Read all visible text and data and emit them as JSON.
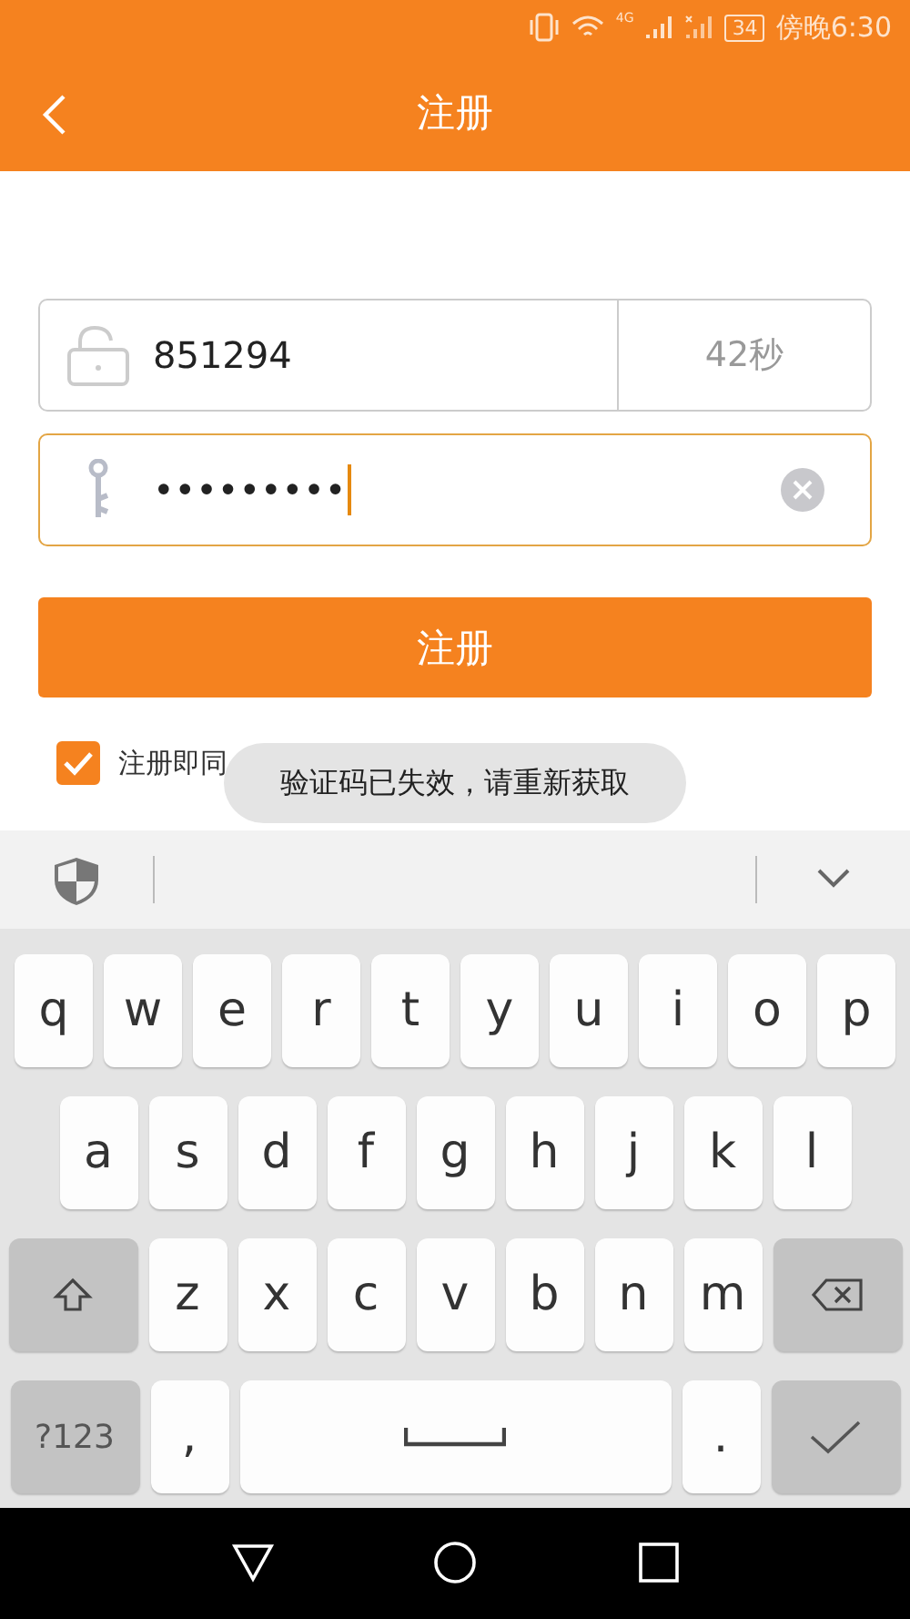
{
  "status_bar": {
    "network": "4G",
    "battery": "34",
    "time": "傍晚6:30"
  },
  "header": {
    "title": "注册"
  },
  "code_field": {
    "value": "851294",
    "countdown": "42秒"
  },
  "password_field": {
    "value": "•••••••••",
    "focused": true
  },
  "submit_button": {
    "label": "注册"
  },
  "agreement": {
    "checked": true,
    "text": "注册即同"
  },
  "toast": {
    "text": "验证码已失效，请重新获取"
  },
  "keyboard": {
    "rows": [
      {
        "keys": [
          {
            "kind": "char",
            "label": "q"
          },
          {
            "kind": "char",
            "label": "w"
          },
          {
            "kind": "char",
            "label": "e"
          },
          {
            "kind": "char",
            "label": "r"
          },
          {
            "kind": "char",
            "label": "t"
          },
          {
            "kind": "char",
            "label": "y"
          },
          {
            "kind": "char",
            "label": "u"
          },
          {
            "kind": "char",
            "label": "i"
          },
          {
            "kind": "char",
            "label": "o"
          },
          {
            "kind": "char",
            "label": "p"
          }
        ]
      },
      {
        "keys": [
          {
            "kind": "char",
            "label": "a"
          },
          {
            "kind": "char",
            "label": "s"
          },
          {
            "kind": "char",
            "label": "d"
          },
          {
            "kind": "char",
            "label": "f"
          },
          {
            "kind": "char",
            "label": "g"
          },
          {
            "kind": "char",
            "label": "h"
          },
          {
            "kind": "char",
            "label": "j"
          },
          {
            "kind": "char",
            "label": "k"
          },
          {
            "kind": "char",
            "label": "l"
          }
        ]
      },
      {
        "keys": [
          {
            "kind": "shift"
          },
          {
            "kind": "char",
            "label": "z"
          },
          {
            "kind": "char",
            "label": "x"
          },
          {
            "kind": "char",
            "label": "c"
          },
          {
            "kind": "char",
            "label": "v"
          },
          {
            "kind": "char",
            "label": "b"
          },
          {
            "kind": "char",
            "label": "n"
          },
          {
            "kind": "char",
            "label": "m"
          },
          {
            "kind": "backspace"
          }
        ]
      },
      {
        "keys": [
          {
            "kind": "mode",
            "label": "?123"
          },
          {
            "kind": "punct",
            "label": ","
          },
          {
            "kind": "space"
          },
          {
            "kind": "punct",
            "label": "."
          },
          {
            "kind": "enter"
          }
        ]
      }
    ]
  }
}
